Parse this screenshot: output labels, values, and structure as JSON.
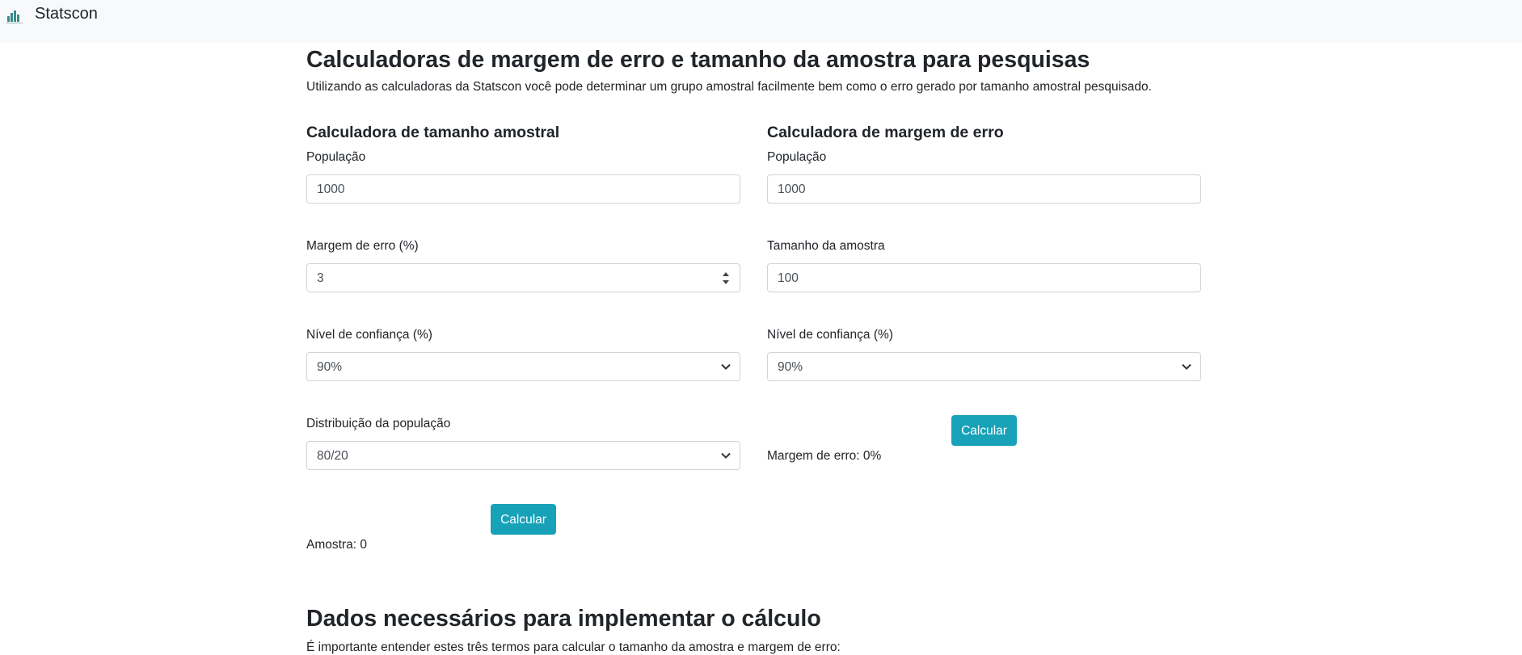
{
  "navbar": {
    "brand": "Statscon",
    "logo_icon": "bar-chart-logo"
  },
  "page": {
    "title": "Calculadoras de margem de erro e tamanho da amostra para pesquisas",
    "lead": "Utilizando as calculadoras da Statscon você pode determinar um grupo amostral facilmente bem como o erro gerado por tamanho amostral pesquisado."
  },
  "sample_calc": {
    "heading": "Calculadora de tamanho amostral",
    "population_label": "População",
    "population_value": "1000",
    "margin_label": "Margem de erro (%)",
    "margin_value": "3",
    "confidence_label": "Nível de confiança (%)",
    "confidence_value": "90%",
    "distribution_label": "Distribuição da população",
    "distribution_value": "80/20",
    "button": "Calcular",
    "result": "Amostra: 0"
  },
  "error_calc": {
    "heading": "Calculadora de margem de erro",
    "population_label": "População",
    "population_value": "1000",
    "sample_label": "Tamanho da amostra",
    "sample_value": "100",
    "confidence_label": "Nível de confiança (%)",
    "confidence_value": "90%",
    "button": "Calcular",
    "result": "Margem de erro: 0%"
  },
  "data_section": {
    "title": "Dados necessários para implementar o cálculo",
    "lead": "É importante entender estes três termos para calcular o tamanho da amostra e margem de erro:"
  },
  "colors": {
    "accent": "#17a2b8",
    "navbar_bg": "#f8f9fa",
    "text": "#212529"
  }
}
